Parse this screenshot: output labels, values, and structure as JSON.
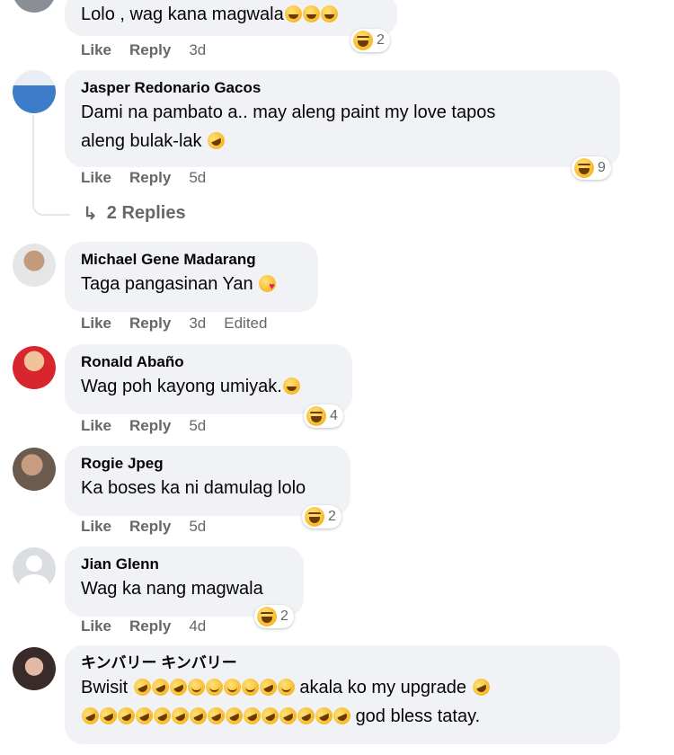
{
  "actions": {
    "like": "Like",
    "reply": "Reply"
  },
  "comments": [
    {
      "author": "",
      "lines": [
        "Lolo , wag kana magwala"
      ],
      "time": "3d",
      "edited": "",
      "reactions": "2"
    },
    {
      "author": "Jasper Redonario Gacos",
      "lines": [
        "Dami na pambato a.. may aleng paint my love tapos",
        "aleng bulak-lak"
      ],
      "time": "5d",
      "edited": "",
      "reactions": "9"
    },
    {
      "author": "Michael Gene Madarang",
      "lines": [
        "Taga pangasinan Yan"
      ],
      "time": "3d",
      "edited": "Edited",
      "reactions": ""
    },
    {
      "author": "Ronald Abaño",
      "lines": [
        "Wag poh kayong umiyak."
      ],
      "time": "5d",
      "edited": "",
      "reactions": "4"
    },
    {
      "author": "Rogie Jpeg",
      "lines": [
        "Ka boses ka ni damulag lolo"
      ],
      "time": "5d",
      "edited": "",
      "reactions": "2"
    },
    {
      "author": "Jian Glenn",
      "lines": [
        "Wag ka nang magwala"
      ],
      "time": "4d",
      "edited": "",
      "reactions": "2"
    },
    {
      "author": "キンバリー キンバリー",
      "lines": [
        "Bwisit",
        "akala ko my upgrade",
        "god bless tatay."
      ],
      "time": "",
      "edited": "",
      "reactions": ""
    }
  ],
  "replies_link": "2 Replies",
  "colors": {
    "bubble": "#f0f2f5",
    "meta": "#65676b",
    "text": "#050505"
  }
}
